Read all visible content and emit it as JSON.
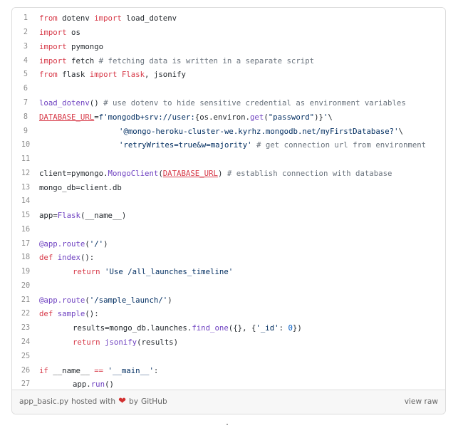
{
  "gist": {
    "lines": [
      {
        "n": "1",
        "tokens": [
          {
            "t": "from",
            "c": "k"
          },
          {
            "t": " dotenv ",
            "c": ""
          },
          {
            "t": "import",
            "c": "k"
          },
          {
            "t": " load_dotenv",
            "c": ""
          }
        ]
      },
      {
        "n": "2",
        "tokens": [
          {
            "t": "import",
            "c": "k"
          },
          {
            "t": " os",
            "c": ""
          }
        ]
      },
      {
        "n": "3",
        "tokens": [
          {
            "t": "import",
            "c": "k"
          },
          {
            "t": " pymongo",
            "c": ""
          }
        ]
      },
      {
        "n": "4",
        "tokens": [
          {
            "t": "import",
            "c": "k"
          },
          {
            "t": " fetch ",
            "c": ""
          },
          {
            "t": "# fetching data is written in a separate script",
            "c": "c"
          }
        ]
      },
      {
        "n": "5",
        "tokens": [
          {
            "t": "from",
            "c": "k"
          },
          {
            "t": " flask ",
            "c": ""
          },
          {
            "t": "import",
            "c": "k"
          },
          {
            "t": " ",
            "c": ""
          },
          {
            "t": "Flask",
            "c": "k"
          },
          {
            "t": ", jsonify",
            "c": ""
          }
        ]
      },
      {
        "n": "6",
        "tokens": []
      },
      {
        "n": "7",
        "tokens": [
          {
            "t": "load_dotenv",
            "c": "f"
          },
          {
            "t": "() ",
            "c": ""
          },
          {
            "t": "# use dotenv to hide sensitive credential as environment variables",
            "c": "c"
          }
        ]
      },
      {
        "n": "8",
        "tokens": [
          {
            "t": "DATABASE_URL",
            "c": "k u"
          },
          {
            "t": "=",
            "c": ""
          },
          {
            "t": "f'mongodb+srv://user:",
            "c": "s"
          },
          {
            "t": "{os.environ.",
            "c": ""
          },
          {
            "t": "get",
            "c": "f"
          },
          {
            "t": "(",
            "c": ""
          },
          {
            "t": "\"password\"",
            "c": "s"
          },
          {
            "t": ")}",
            "c": ""
          },
          {
            "t": "'",
            "c": "s"
          },
          {
            "t": "\\",
            "c": ""
          }
        ]
      },
      {
        "n": "9",
        "indent": "wide",
        "tokens": [
          {
            "t": "'@mongo-heroku-cluster-we.kyrhz.mongodb.net/myFirstDatabase?'",
            "c": "s"
          },
          {
            "t": "\\",
            "c": ""
          }
        ]
      },
      {
        "n": "10",
        "indent": "wide",
        "tokens": [
          {
            "t": "'retryWrites=true&w=majority'",
            "c": "s"
          },
          {
            "t": " ",
            "c": ""
          },
          {
            "t": "# get connection url from environment",
            "c": "c"
          }
        ]
      },
      {
        "n": "11",
        "tokens": []
      },
      {
        "n": "12",
        "tokens": [
          {
            "t": "client",
            "c": ""
          },
          {
            "t": "=",
            "c": ""
          },
          {
            "t": "pymongo.",
            "c": ""
          },
          {
            "t": "MongoClient",
            "c": "f"
          },
          {
            "t": "(",
            "c": ""
          },
          {
            "t": "DATABASE_URL",
            "c": "k u"
          },
          {
            "t": ") ",
            "c": ""
          },
          {
            "t": "# establish connection with database",
            "c": "c"
          }
        ]
      },
      {
        "n": "13",
        "tokens": [
          {
            "t": "mongo_db",
            "c": ""
          },
          {
            "t": "=",
            "c": ""
          },
          {
            "t": "client.db",
            "c": ""
          }
        ]
      },
      {
        "n": "14",
        "tokens": []
      },
      {
        "n": "15",
        "tokens": [
          {
            "t": "app",
            "c": ""
          },
          {
            "t": "=",
            "c": ""
          },
          {
            "t": "Flask",
            "c": "f"
          },
          {
            "t": "(__name__)",
            "c": ""
          }
        ]
      },
      {
        "n": "16",
        "tokens": []
      },
      {
        "n": "17",
        "tokens": [
          {
            "t": "@app.route",
            "c": "f"
          },
          {
            "t": "(",
            "c": ""
          },
          {
            "t": "'/'",
            "c": "s"
          },
          {
            "t": ")",
            "c": ""
          }
        ]
      },
      {
        "n": "18",
        "tokens": [
          {
            "t": "def",
            "c": "k"
          },
          {
            "t": " ",
            "c": ""
          },
          {
            "t": "index",
            "c": "f"
          },
          {
            "t": "():",
            "c": ""
          }
        ]
      },
      {
        "n": "19",
        "indent": "one",
        "tokens": [
          {
            "t": "return",
            "c": "k"
          },
          {
            "t": " ",
            "c": ""
          },
          {
            "t": "'Use /all_launches_timeline'",
            "c": "s"
          }
        ]
      },
      {
        "n": "20",
        "tokens": []
      },
      {
        "n": "21",
        "tokens": [
          {
            "t": "@app.route",
            "c": "f"
          },
          {
            "t": "(",
            "c": ""
          },
          {
            "t": "'/sample_launch/'",
            "c": "s"
          },
          {
            "t": ")",
            "c": ""
          }
        ]
      },
      {
        "n": "22",
        "tokens": [
          {
            "t": "def",
            "c": "k"
          },
          {
            "t": " ",
            "c": ""
          },
          {
            "t": "sample",
            "c": "f"
          },
          {
            "t": "():",
            "c": ""
          }
        ]
      },
      {
        "n": "23",
        "indent": "one",
        "tokens": [
          {
            "t": "results",
            "c": ""
          },
          {
            "t": "=",
            "c": ""
          },
          {
            "t": "mongo_db.launches.",
            "c": ""
          },
          {
            "t": "find_one",
            "c": "f"
          },
          {
            "t": "({}, {",
            "c": ""
          },
          {
            "t": "'_id'",
            "c": "s"
          },
          {
            "t": ": ",
            "c": ""
          },
          {
            "t": "0",
            "c": "n"
          },
          {
            "t": "})",
            "c": ""
          }
        ]
      },
      {
        "n": "24",
        "indent": "one",
        "tokens": [
          {
            "t": "return",
            "c": "k"
          },
          {
            "t": " ",
            "c": ""
          },
          {
            "t": "jsonify",
            "c": "f"
          },
          {
            "t": "(results)",
            "c": ""
          }
        ]
      },
      {
        "n": "25",
        "tokens": []
      },
      {
        "n": "26",
        "tokens": [
          {
            "t": "if",
            "c": "k"
          },
          {
            "t": " __name__ ",
            "c": ""
          },
          {
            "t": "==",
            "c": "k"
          },
          {
            "t": " ",
            "c": ""
          },
          {
            "t": "'__main__'",
            "c": "s"
          },
          {
            "t": ":",
            "c": ""
          }
        ]
      },
      {
        "n": "27",
        "indent": "one",
        "tokens": [
          {
            "t": "app.",
            "c": ""
          },
          {
            "t": "run",
            "c": "f"
          },
          {
            "t": "()",
            "c": ""
          }
        ]
      }
    ],
    "footer": {
      "file_name": "app_basic.py",
      "hosted_with": "hosted with",
      "by": "by",
      "host": "GitHub",
      "view_raw": "view raw"
    },
    "icons": {
      "heart": "heart-icon"
    },
    "colors": {
      "keyword": "#d73a49",
      "function": "#6f42c1",
      "string": "#032f62",
      "comment": "#6a737d",
      "number": "#005cc5",
      "heart": "#d22f2f"
    }
  }
}
